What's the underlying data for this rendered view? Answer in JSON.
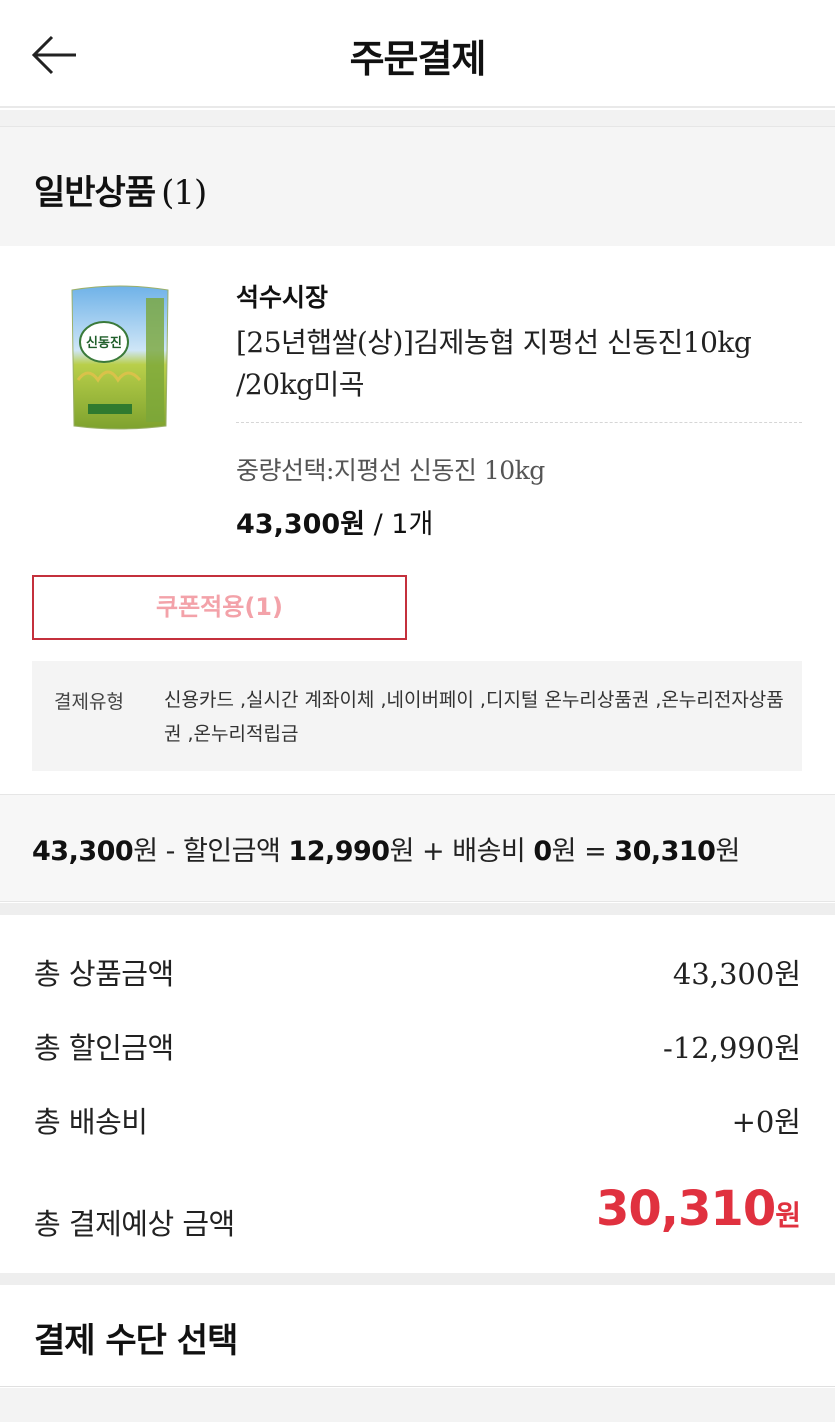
{
  "header": {
    "title": "주문결제",
    "back_icon": "arrow-left-icon"
  },
  "section": {
    "label": "일반상품",
    "count": "(1)"
  },
  "product": {
    "store": "석수시장",
    "name": "[25년햅쌀(상)]김제농협 지평선 신동진10kg /20kg미곡",
    "option": "중량선택:지평선 신동진 10kg",
    "price": "43,300원",
    "qty": "/ 1개",
    "coupon_button": "쿠폰적용(1)",
    "thumbnail_label": "신동진"
  },
  "payment_types": {
    "label": "결제유형",
    "value": "신용카드 ,실시간 계좌이체 ,네이버페이 ,디지털 온누리상품권 ,온누리전자상품권 ,온누리적립금"
  },
  "summary": {
    "product_amount": "43,300",
    "won1": "원",
    "minus_discount": " - 할인금액 ",
    "discount": "12,990",
    "won2": "원",
    "plus_shipping": " + 배송비 ",
    "shipping": "0",
    "won3": "원",
    "equals": " = ",
    "total": "30,310",
    "won4": "원"
  },
  "totals": {
    "product_label": "총 상품금액",
    "product_value": "43,300원",
    "discount_label": "총 할인금액",
    "discount_value": "-12,990원",
    "shipping_label": "총 배송비",
    "shipping_value": "+0원",
    "final_label": "총 결제예상 금액",
    "final_value": "30,310",
    "final_unit": "원"
  },
  "payment_method": {
    "title": "결제 수단 선택"
  },
  "colors": {
    "accent": "#e0313f",
    "coupon_border": "#c4303c"
  }
}
